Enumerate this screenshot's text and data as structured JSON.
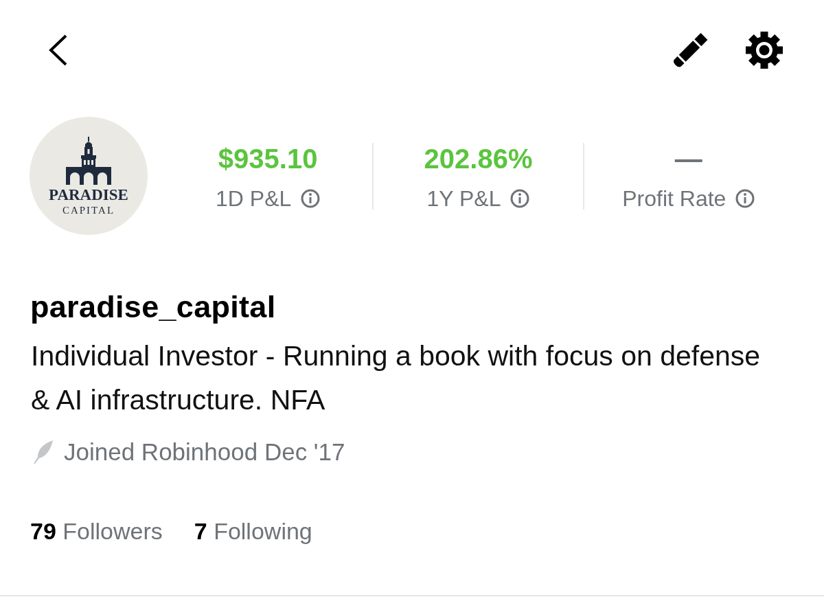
{
  "profile": {
    "avatar": {
      "logo_name": "PARADISE",
      "logo_tagline": "CAPITAL"
    },
    "stats": [
      {
        "value": "$935.10",
        "label": "1D P&L",
        "color": "#5bc43e"
      },
      {
        "value": "202.86%",
        "label": "1Y P&L",
        "color": "#5bc43e"
      },
      {
        "value": "—",
        "label": "Profit Rate",
        "color": "#6e7378"
      }
    ],
    "username": "paradise_capital",
    "bio": "Individual Investor - Running a book with focus on defense & AI infrastructure. NFA",
    "joined": "Joined Robinhood Dec '17",
    "counts": [
      {
        "count": "79",
        "label": "Followers"
      },
      {
        "count": "7",
        "label": "Following"
      }
    ]
  }
}
